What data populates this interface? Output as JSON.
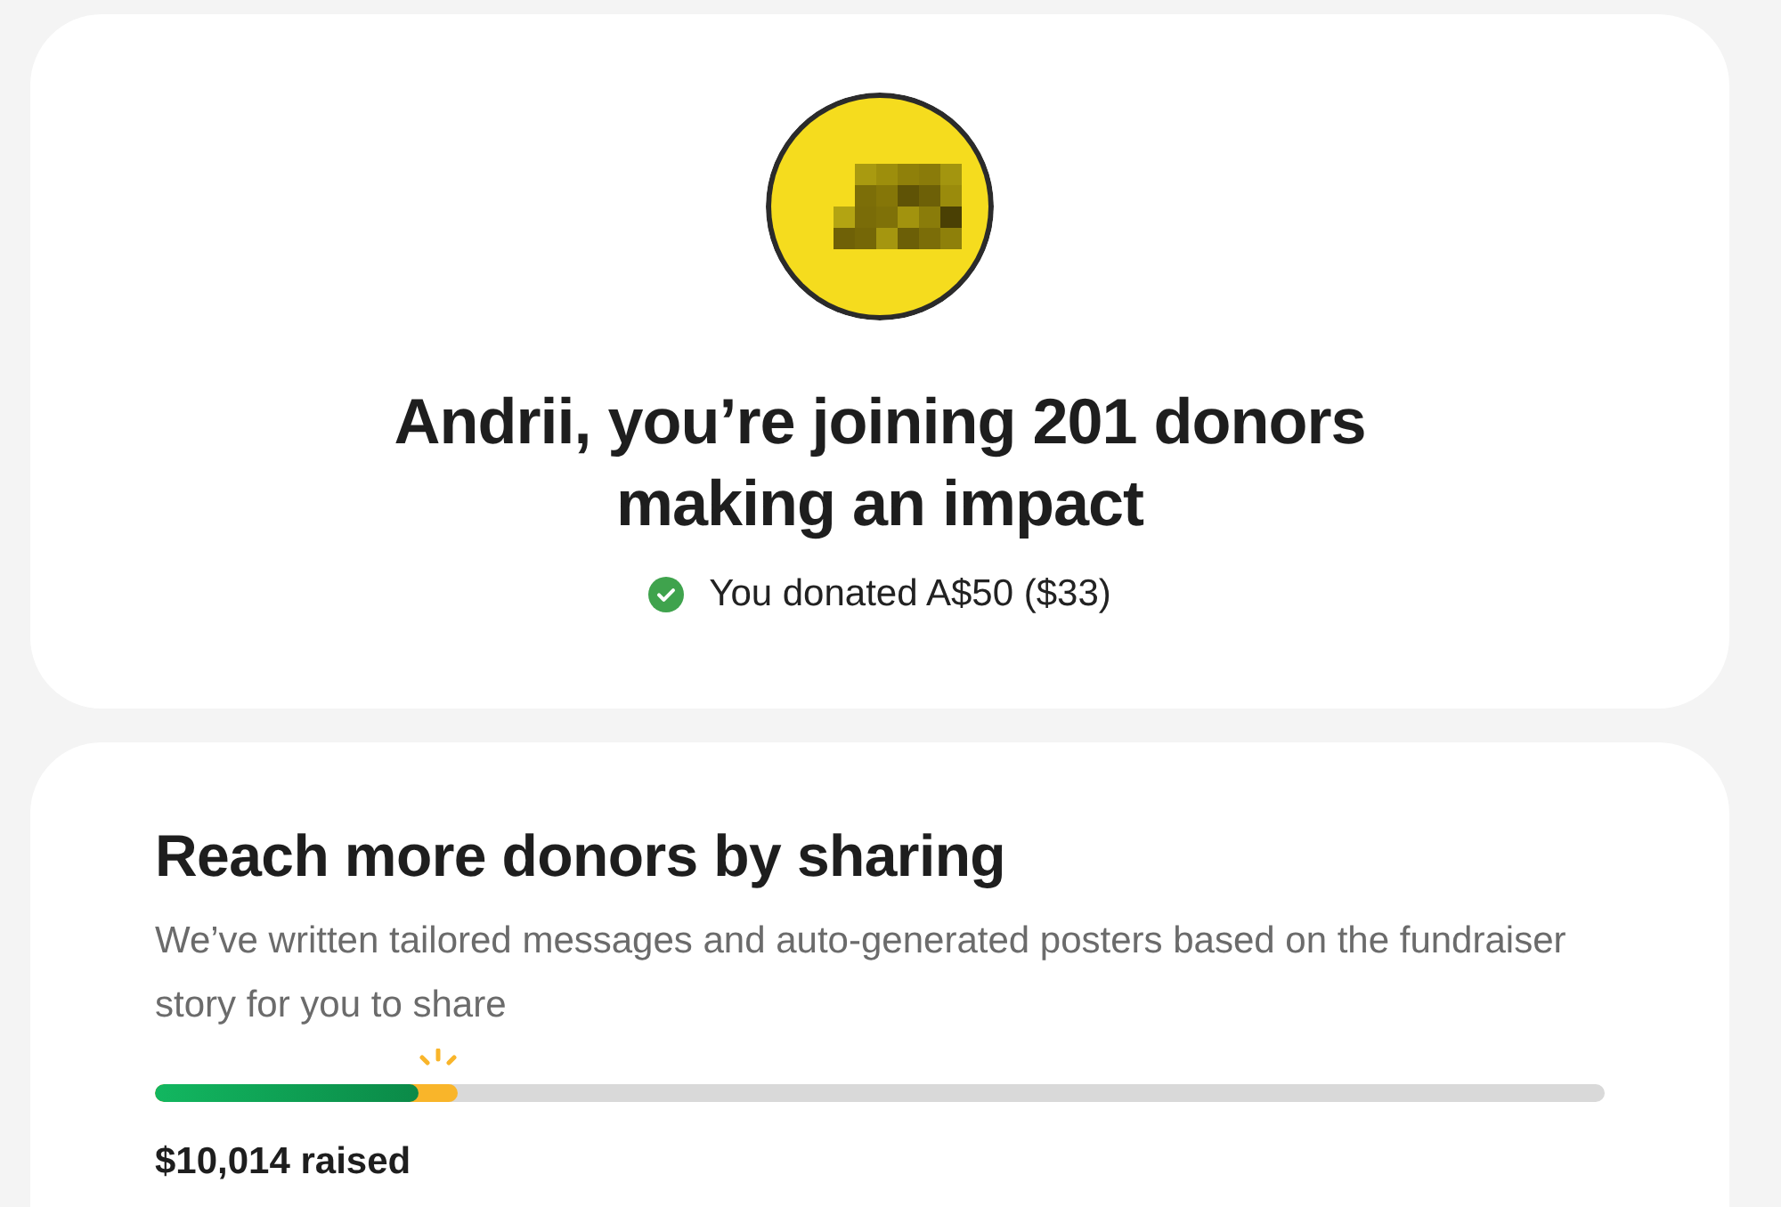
{
  "header_card": {
    "title": "Andrii, you’re joining 201 donors making an impact",
    "donation_status": {
      "confirmed": true,
      "text": "You donated A$50 ($33)"
    }
  },
  "share_card": {
    "heading": "Reach more donors by sharing",
    "description": "We’ve written tailored messages and auto-generated posters based on the fundraiser story for you to share",
    "progress": {
      "level": 0.182
    },
    "with_your_donation": {
      "level": 0.209
    },
    "raised": "$10,014 raised"
  }
}
